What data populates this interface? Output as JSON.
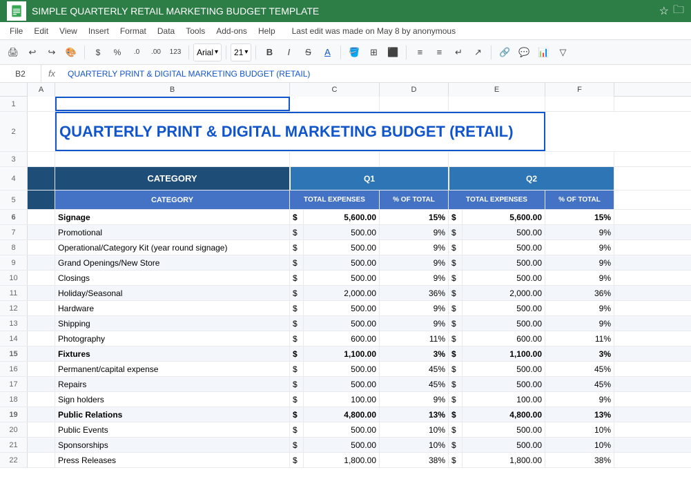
{
  "topbar": {
    "title": "SIMPLE QUARTERLY RETAIL MARKETING BUDGET TEMPLATE",
    "star_icon": "☆",
    "folder_icon": "🗀"
  },
  "menubar": {
    "items": [
      "File",
      "Edit",
      "View",
      "Insert",
      "Format",
      "Data",
      "Tools",
      "Add-ons",
      "Help"
    ],
    "last_edit": "Last edit was made on May 8 by anonymous"
  },
  "formula_bar": {
    "cell_ref": "B2",
    "formula": "QUARTERLY PRINT & DIGITAL MARKETING BUDGET (RETAIL)"
  },
  "spreadsheet": {
    "title": "QUARTERLY PRINT & DIGITAL MARKETING BUDGET (RETAIL)",
    "headers": {
      "category": "CATEGORY",
      "q1": "Q1",
      "q2": "Q2",
      "total_expenses": "TOTAL EXPENSES",
      "pct_of_total": "% OF TOTAL"
    },
    "rows": [
      {
        "num": 6,
        "category": "Signage",
        "bold": true,
        "q1_dollar": "$",
        "q1_val": "5,600.00",
        "q1_pct": "15%",
        "q2_dollar": "$",
        "q2_val": "5,600.00",
        "q2_pct": "15%"
      },
      {
        "num": 7,
        "category": "Promotional",
        "bold": false,
        "q1_dollar": "$",
        "q1_val": "500.00",
        "q1_pct": "9%",
        "q2_dollar": "$",
        "q2_val": "500.00",
        "q2_pct": "9%"
      },
      {
        "num": 8,
        "category": "Operational/Category Kit (year round signage)",
        "bold": false,
        "q1_dollar": "$",
        "q1_val": "500.00",
        "q1_pct": "9%",
        "q2_dollar": "$",
        "q2_val": "500.00",
        "q2_pct": "9%"
      },
      {
        "num": 9,
        "category": "Grand Openings/New Store",
        "bold": false,
        "q1_dollar": "$",
        "q1_val": "500.00",
        "q1_pct": "9%",
        "q2_dollar": "$",
        "q2_val": "500.00",
        "q2_pct": "9%"
      },
      {
        "num": 10,
        "category": "Closings",
        "bold": false,
        "q1_dollar": "$",
        "q1_val": "500.00",
        "q1_pct": "9%",
        "q2_dollar": "$",
        "q2_val": "500.00",
        "q2_pct": "9%"
      },
      {
        "num": 11,
        "category": "Holiday/Seasonal",
        "bold": false,
        "q1_dollar": "$",
        "q1_val": "2,000.00",
        "q1_pct": "36%",
        "q2_dollar": "$",
        "q2_val": "2,000.00",
        "q2_pct": "36%"
      },
      {
        "num": 12,
        "category": "Hardware",
        "bold": false,
        "q1_dollar": "$",
        "q1_val": "500.00",
        "q1_pct": "9%",
        "q2_dollar": "$",
        "q2_val": "500.00",
        "q2_pct": "9%"
      },
      {
        "num": 13,
        "category": "Shipping",
        "bold": false,
        "q1_dollar": "$",
        "q1_val": "500.00",
        "q1_pct": "9%",
        "q2_dollar": "$",
        "q2_val": "500.00",
        "q2_pct": "9%"
      },
      {
        "num": 14,
        "category": "Photography",
        "bold": false,
        "q1_dollar": "$",
        "q1_val": "600.00",
        "q1_pct": "11%",
        "q2_dollar": "$",
        "q2_val": "600.00",
        "q2_pct": "11%"
      },
      {
        "num": 15,
        "category": "Fixtures",
        "bold": true,
        "q1_dollar": "$",
        "q1_val": "1,100.00",
        "q1_pct": "3%",
        "q2_dollar": "$",
        "q2_val": "1,100.00",
        "q2_pct": "3%"
      },
      {
        "num": 16,
        "category": "Permanent/capital expense",
        "bold": false,
        "q1_dollar": "$",
        "q1_val": "500.00",
        "q1_pct": "45%",
        "q2_dollar": "$",
        "q2_val": "500.00",
        "q2_pct": "45%"
      },
      {
        "num": 17,
        "category": "Repairs",
        "bold": false,
        "q1_dollar": "$",
        "q1_val": "500.00",
        "q1_pct": "45%",
        "q2_dollar": "$",
        "q2_val": "500.00",
        "q2_pct": "45%"
      },
      {
        "num": 18,
        "category": "Sign holders",
        "bold": false,
        "q1_dollar": "$",
        "q1_val": "100.00",
        "q1_pct": "9%",
        "q2_dollar": "$",
        "q2_val": "100.00",
        "q2_pct": "9%"
      },
      {
        "num": 19,
        "category": "Public Relations",
        "bold": true,
        "q1_dollar": "$",
        "q1_val": "4,800.00",
        "q1_pct": "13%",
        "q2_dollar": "$",
        "q2_val": "4,800.00",
        "q2_pct": "13%"
      },
      {
        "num": 20,
        "category": "Public Events",
        "bold": false,
        "q1_dollar": "$",
        "q1_val": "500.00",
        "q1_pct": "10%",
        "q2_dollar": "$",
        "q2_val": "500.00",
        "q2_pct": "10%"
      },
      {
        "num": 21,
        "category": "Sponsorships",
        "bold": false,
        "q1_dollar": "$",
        "q1_val": "500.00",
        "q1_pct": "10%",
        "q2_dollar": "$",
        "q2_val": "500.00",
        "q2_pct": "10%"
      },
      {
        "num": 22,
        "category": "Press Releases",
        "bold": false,
        "q1_dollar": "$",
        "q1_val": "1,800.00",
        "q1_pct": "38%",
        "q2_dollar": "$",
        "q2_val": "1,800.00",
        "q2_pct": "38%"
      }
    ],
    "col_widths": {
      "a": 40,
      "b": 340,
      "c_dollar": 20,
      "c_val": 110,
      "d": 100,
      "e_dollar": 20,
      "e_val": 120,
      "f": 100
    }
  }
}
